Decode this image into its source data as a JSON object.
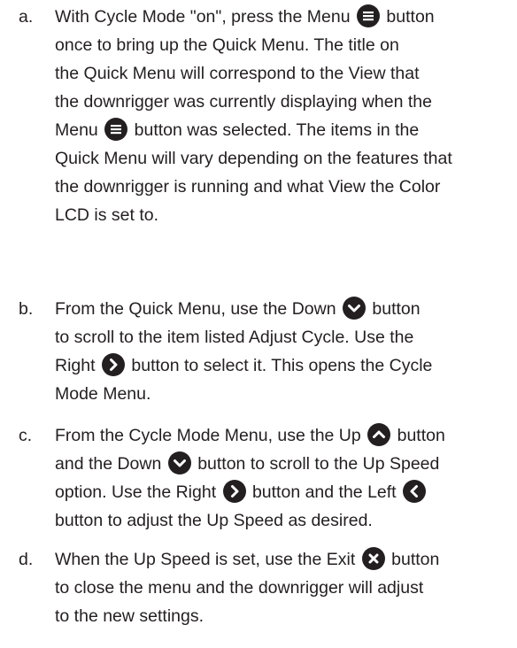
{
  "steps": [
    {
      "letter": "a.",
      "parts": [
        "With Cycle Mode \"on\", press the Menu",
        "button",
        "once to bring up the Quick Menu. The title on",
        "the Quick Menu will correspond to the View that",
        "the downrigger was currently displaying when the",
        "Menu",
        "button was selected. The items in the",
        "Quick Menu will vary depending on the features that",
        "the downrigger is running and what View the Color",
        "LCD is set to."
      ]
    },
    {
      "letter": "b.",
      "parts": [
        "From the Quick Menu, use the Down",
        "button",
        "to scroll to the item listed Adjust Cycle. Use the",
        "Right",
        "button to select it. This opens the Cycle",
        "Mode Menu."
      ]
    },
    {
      "letter": "c.",
      "parts": [
        "From the Cycle Mode Menu, use the Up",
        "button",
        "and the Down",
        "button to scroll to the Up Speed",
        "option. Use the Right",
        "button and the Left",
        "button to adjust the Up Speed as desired."
      ]
    },
    {
      "letter": "d.",
      "parts": [
        "When the Up Speed is set, use the Exit",
        "button",
        "to close the menu and the downrigger will adjust",
        "to the new settings."
      ]
    }
  ],
  "icons": {
    "menu": "menu-button-icon",
    "down": "down-button-icon",
    "up": "up-button-icon",
    "right": "right-button-icon",
    "left": "left-button-icon",
    "exit": "exit-button-icon",
    "color": "#231f20"
  }
}
